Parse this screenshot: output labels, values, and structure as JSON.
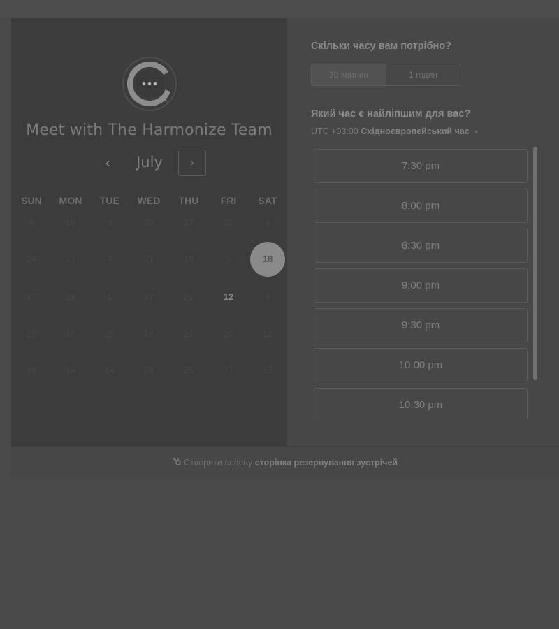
{
  "header": {
    "team_name": "Meet with The Harmonize Team"
  },
  "icons": {
    "logo": "chat-bubble-logo-icon",
    "prev": "chevron-left-icon",
    "next": "chevron-right-icon",
    "timezone_dropdown": "caret-down-icon",
    "footer": "hubspot-sprocket-icon"
  },
  "calendar": {
    "month": "July",
    "prev_symbol": "‹",
    "next_symbol": "›",
    "weekdays": [
      "SUN",
      "MON",
      "TUE",
      "WED",
      "THU",
      "FRI",
      "SAT"
    ],
    "weeks": [
      [
        {
          "day": "6"
        },
        {
          "day": "19"
        },
        {
          "day": "4"
        },
        {
          "day": "20"
        },
        {
          "day": "27"
        },
        {
          "day": "22"
        },
        {
          "day": "8"
        }
      ],
      [
        {
          "day": "24"
        },
        {
          "day": "21"
        },
        {
          "day": "4"
        },
        {
          "day": "21"
        },
        {
          "day": "19"
        },
        {
          "day": "5"
        },
        {
          "day": "18",
          "selected": true
        }
      ],
      [
        {
          "day": "17"
        },
        {
          "day": "29"
        },
        {
          "day": "1"
        },
        {
          "day": "17"
        },
        {
          "day": "21"
        },
        {
          "day": "12",
          "available": true
        },
        {
          "day": "3"
        }
      ],
      [
        {
          "day": "20"
        },
        {
          "day": "14"
        },
        {
          "day": "28"
        },
        {
          "day": "14"
        },
        {
          "day": "21"
        },
        {
          "day": "20"
        },
        {
          "day": "12"
        }
      ],
      [
        {
          "day": "19"
        },
        {
          "day": "14"
        },
        {
          "day": "14"
        },
        {
          "day": "28"
        },
        {
          "day": "25"
        },
        {
          "day": "17"
        },
        {
          "day": "13"
        }
      ]
    ]
  },
  "scheduler": {
    "duration_question": "Скільки часу вам потрібно?",
    "durations": [
      {
        "label": "30 хвилин",
        "active": true
      },
      {
        "label": "1 годин",
        "active": false
      }
    ],
    "time_question": "Який час є найліпшим для вас?",
    "timezone_offset": "UTC +03:00",
    "timezone_name": "Східноєвропейський час",
    "timezone_caret": "▾",
    "slots": [
      "7:30 pm",
      "8:00 pm",
      "8:30 pm",
      "9:00 pm",
      "9:30 pm",
      "10:00 pm",
      "10:30 pm"
    ]
  },
  "footer": {
    "prefix": "Створити власну",
    "link": "сторінка резервування зустрічей"
  }
}
